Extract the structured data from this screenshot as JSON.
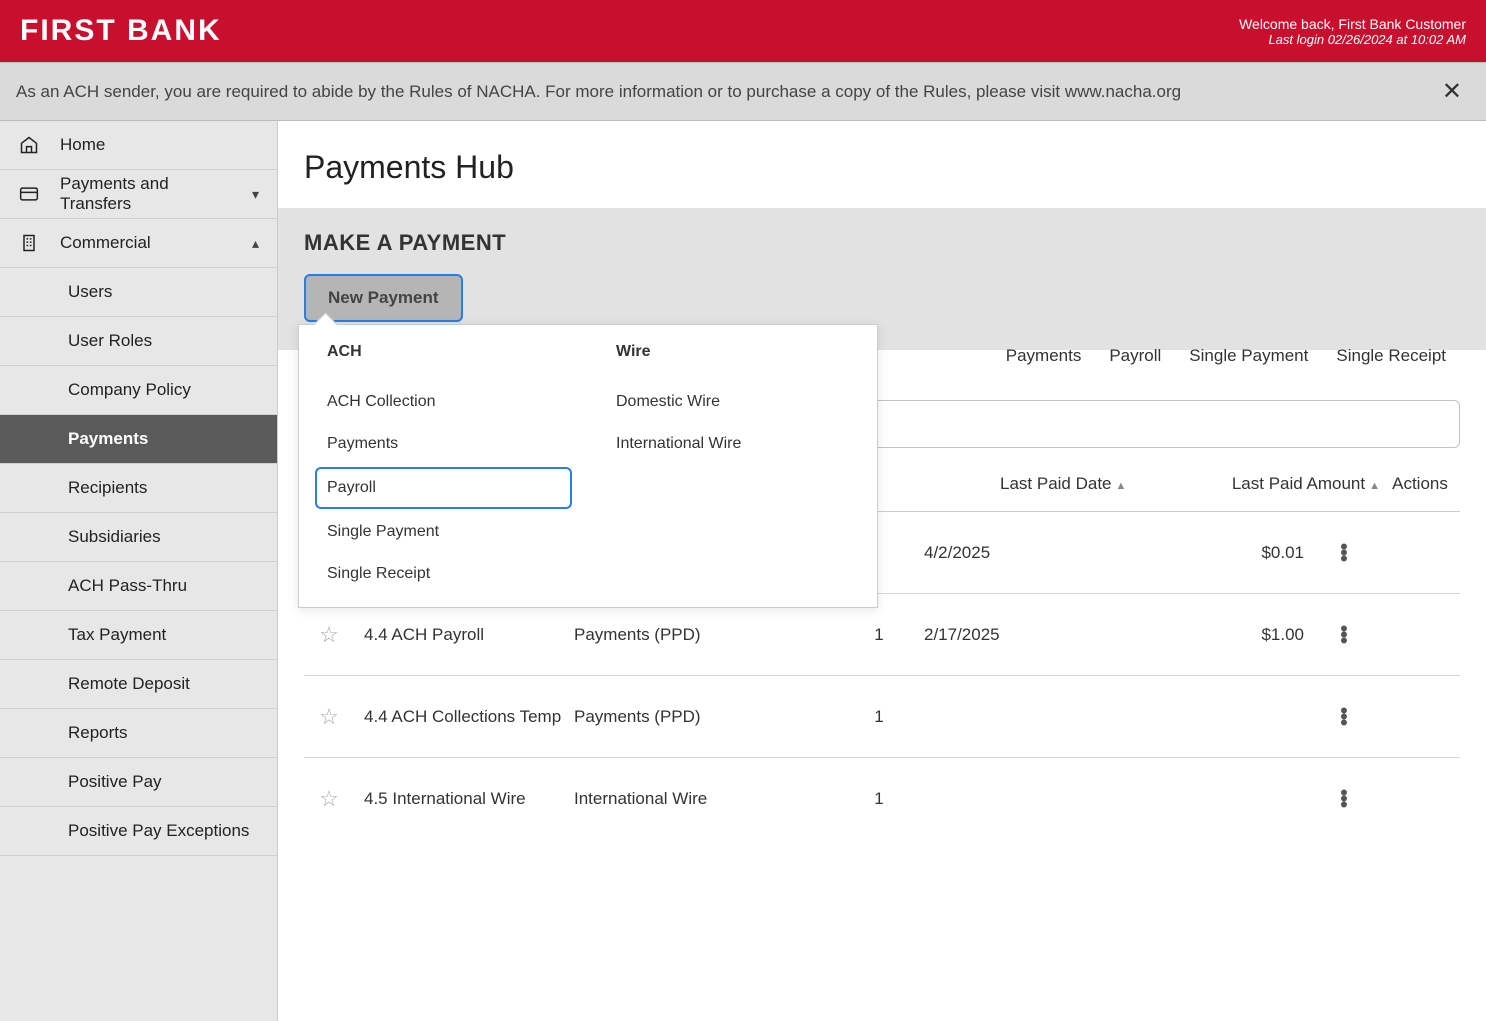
{
  "header": {
    "logo": "FIRST BANK",
    "welcome": "Welcome back, First Bank Customer",
    "last_login": "Last login 02/26/2024 at 10:02 AM"
  },
  "notice": {
    "text": "As an ACH sender, you are required to abide by the Rules of NACHA. For more information or to purchase a copy of the Rules, please visit www.nacha.org"
  },
  "sidebar": {
    "nav": [
      {
        "label": "Home",
        "icon": "home-icon",
        "chevron": ""
      },
      {
        "label": "Payments and Transfers",
        "icon": "card-icon",
        "chevron": "down"
      },
      {
        "label": "Commercial",
        "icon": "building-icon",
        "chevron": "up"
      }
    ],
    "sub": [
      {
        "label": "Users",
        "active": false
      },
      {
        "label": "User Roles",
        "active": false
      },
      {
        "label": "Company Policy",
        "active": false
      },
      {
        "label": "Payments",
        "active": true
      },
      {
        "label": "Recipients",
        "active": false
      },
      {
        "label": "Subsidiaries",
        "active": false
      },
      {
        "label": "ACH Pass-Thru",
        "active": false
      },
      {
        "label": "Tax Payment",
        "active": false
      },
      {
        "label": "Remote Deposit",
        "active": false
      },
      {
        "label": "Reports",
        "active": false
      },
      {
        "label": "Positive Pay",
        "active": false
      },
      {
        "label": "Positive Pay Exceptions",
        "active": false
      }
    ]
  },
  "page": {
    "title": "Payments Hub",
    "make_payment_heading": "MAKE A PAYMENT",
    "new_payment_button": "New Payment"
  },
  "flyout": {
    "ach_heading": "ACH",
    "ach_items": [
      "ACH Collection",
      "Payments",
      "Payroll",
      "Single Payment",
      "Single Receipt"
    ],
    "highlighted": "Payroll",
    "wire_heading": "Wire",
    "wire_items": [
      "Domestic Wire",
      "International Wire"
    ]
  },
  "chips": [
    "Payments",
    "Payroll",
    "Single Payment",
    "Single Receipt"
  ],
  "search": {
    "placeholder": ""
  },
  "table": {
    "header_date": "Last Paid Date",
    "header_amount": "Last Paid Amount",
    "header_actions": "Actions",
    "rows": [
      {
        "name": "",
        "type": "",
        "count": "",
        "date": "4/2/2025",
        "amount": "$0.01"
      },
      {
        "name": "4.4 ACH Payroll",
        "type": "Payments (PPD)",
        "count": "1",
        "date": "2/17/2025",
        "amount": "$1.00"
      },
      {
        "name": "4.4 ACH Collections Temp",
        "type": "Payments (PPD)",
        "count": "1",
        "date": "",
        "amount": ""
      },
      {
        "name": "4.5 International Wire",
        "type": "International Wire",
        "count": "1",
        "date": "",
        "amount": ""
      }
    ]
  }
}
